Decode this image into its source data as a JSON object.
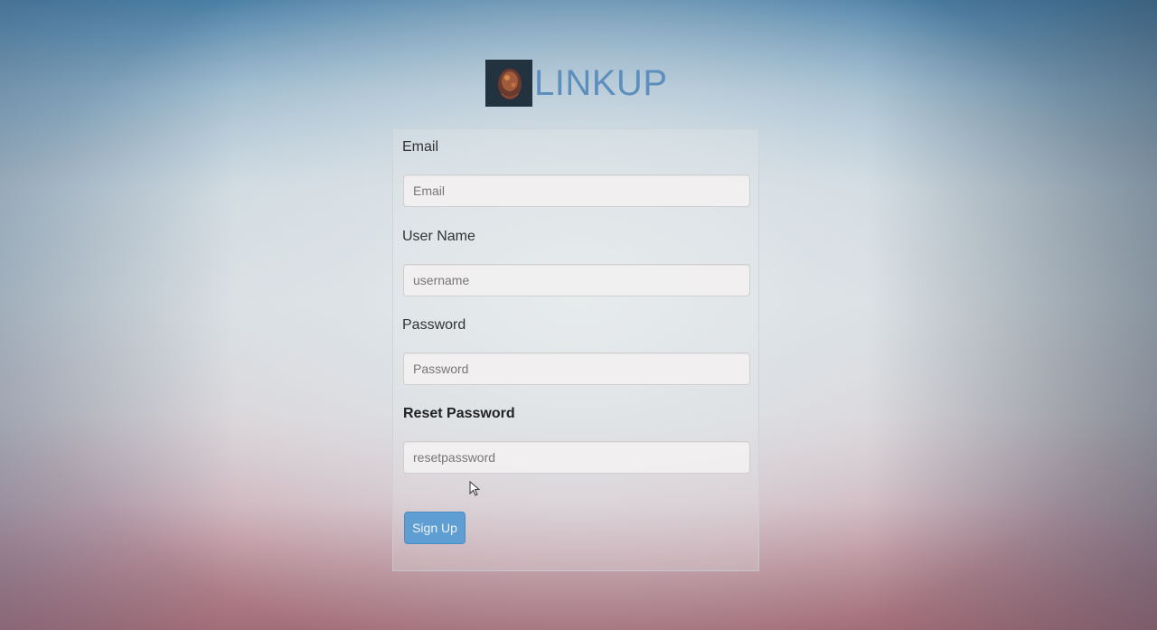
{
  "brand": {
    "name": "LINKUP",
    "color": "#5d8fbe"
  },
  "form": {
    "email": {
      "label": "Email",
      "placeholder": "Email"
    },
    "username": {
      "label": "User Name",
      "placeholder": "username"
    },
    "password": {
      "label": "Password",
      "placeholder": "Password"
    },
    "reset_password": {
      "label": "Reset Password",
      "placeholder": "resetpassword"
    },
    "submit": {
      "label": "Sign Up",
      "color": "#5f9ed2"
    }
  },
  "icons": {
    "logo": "linkup-logo-icon",
    "cursor": "mouse-cursor-icon"
  }
}
